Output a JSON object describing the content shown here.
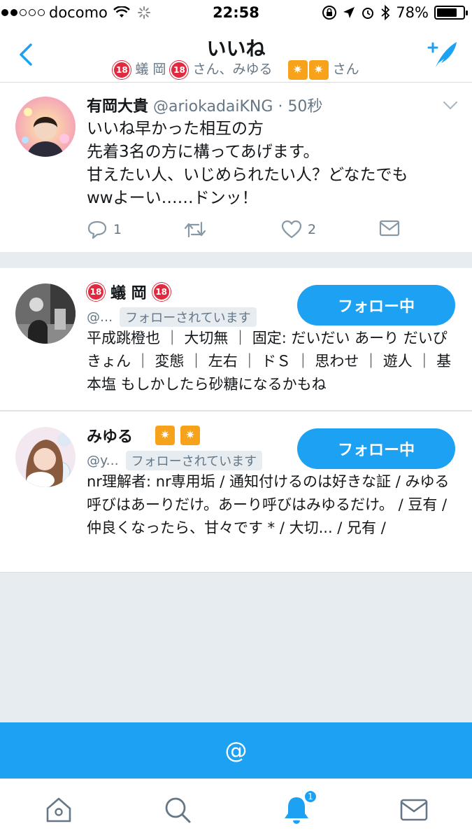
{
  "status_bar": {
    "carrier": "docomo",
    "time": "22:58",
    "battery": "78%",
    "battery_level": 0.78
  },
  "nav": {
    "title": "いいね",
    "subtitle_user1": "蟻 岡",
    "subtitle_sep": "さん、みゆる",
    "subtitle_suffix": "さん",
    "badge18": "18",
    "star": "✷"
  },
  "tweet": {
    "name": "有岡大貴",
    "handle": "@ariokadaiKNG",
    "time": "· 50秒",
    "lines": [
      "いいね早かった相互の方",
      "先着3名の方に構ってあげます。",
      "甘えたい人、いじめられたい人？どなたでも",
      "wwよーい……ドンッ！"
    ],
    "reply_count": "1",
    "like_count": "2"
  },
  "users": [
    {
      "name": "蟻 岡",
      "handle": "@...",
      "follows_you": "フォローされています",
      "button": "フォロー中",
      "bio": "平成跳橙也 ｜ 大切無 ｜ 固定: だいだい あーり だいぴ きょん ｜ 変態 ｜ 左右 ｜ ドＳ ｜ 思わせ ｜ 遊人 ｜ 基本塩 もしかしたら砂糖になるかもね"
    },
    {
      "name": "みゆる",
      "handle": "@y...",
      "follows_you": "フォローされています",
      "button": "フォロー中",
      "bio": "nr理解者: nr専用垢 / 通知付けるのは好きな証 / みゆる呼びはあーりだけ。あーり呼びはみゆるだけ。 / 豆有 / 仲良くなったら、甘々です * / 大切... / 兄有 /"
    }
  ],
  "mentions": {
    "label": "@"
  },
  "tabbar": {
    "notification_count": "1"
  },
  "colors": {
    "accent": "#1da1f2",
    "background": "#e6ecf0"
  }
}
